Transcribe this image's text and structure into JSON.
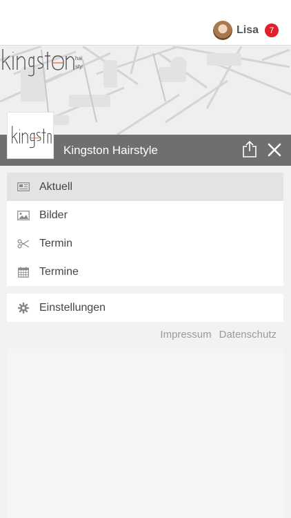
{
  "user": {
    "name": "Lisa",
    "notification_count": "7"
  },
  "header": {
    "title": "Kingston Hairstyle"
  },
  "menu": {
    "items": [
      {
        "label": "Aktuell",
        "icon": "newspaper-icon",
        "active": true
      },
      {
        "label": "Bilder",
        "icon": "image-icon",
        "active": false
      },
      {
        "label": "Termin",
        "icon": "scissors-icon",
        "active": false
      },
      {
        "label": "Termine",
        "icon": "calendar-icon",
        "active": false
      }
    ]
  },
  "settings": {
    "label": "Einstellungen",
    "icon": "gear-icon"
  },
  "footer": {
    "impressum": "Impressum",
    "datenschutz": "Datenschutz"
  },
  "colors": {
    "badge": "#e0202a",
    "titlebar": "#6f6f6f",
    "active_row": "#e3e3e3",
    "accent": "#e3622c"
  }
}
